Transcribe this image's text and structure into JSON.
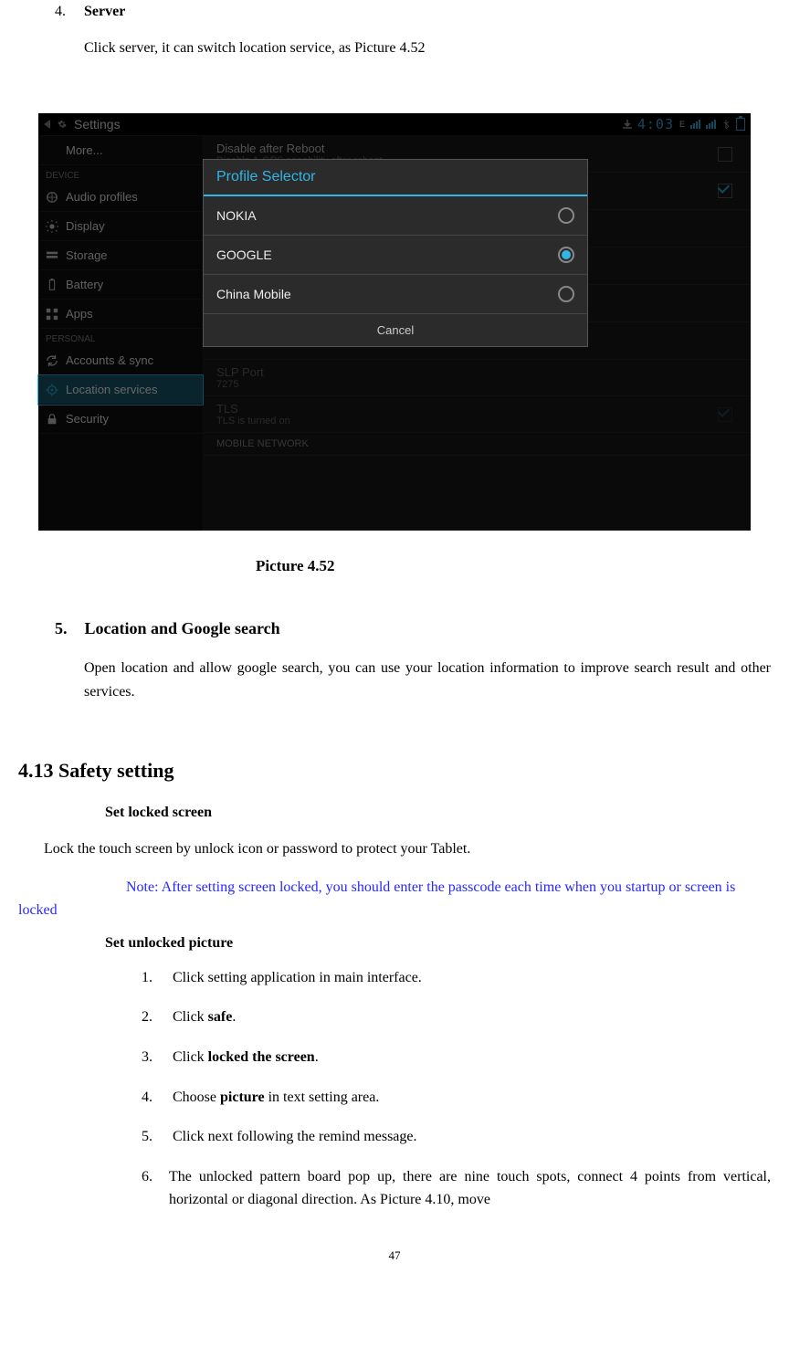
{
  "item4": {
    "num": "4.",
    "title": "Server",
    "body": "Click server, it can switch location service, as Picture 4.52"
  },
  "screenshot": {
    "statusbar": {
      "title": "Settings",
      "clock": "4:03"
    },
    "left_panel": {
      "more": "More...",
      "device_header": "DEVICE",
      "audio": "Audio profiles",
      "display": "Display",
      "storage": "Storage",
      "battery": "Battery",
      "apps": "Apps",
      "personal_header": "PERSONAL",
      "accounts": "Accounts & sync",
      "location": "Location services",
      "security": "Security"
    },
    "right_panel": {
      "disable_title": "Disable after Reboot",
      "disable_sub": "Disable A-GPS capability after reboot",
      "slp_title": "SLP Port",
      "slp_sub": "7275",
      "tls_title": "TLS",
      "tls_sub": "TLS is turned on",
      "mobile_header": "MOBILE NETWORK"
    },
    "dialog": {
      "title": "Profile Selector",
      "opt1": "NOKIA",
      "opt2": "GOOGLE",
      "opt3": "China Mobile",
      "cancel": "Cancel"
    }
  },
  "caption": "Picture 4.52",
  "item5": {
    "num": "5.",
    "title": "Location and Google search",
    "body": "Open location and allow google search, you can use your location information to improve search result and other services."
  },
  "heading413": "4.13  Safety setting",
  "sub_locked": "Set locked screen",
  "lock_line": "Lock the touch screen by unlock icon or password to protect your Tablet.",
  "note_blue": "Note: After setting screen locked, you should enter the passcode each time when you startup or screen is locked",
  "sub_unlocked": "Set unlocked picture",
  "steps": {
    "s1n": "1.",
    "s1": "Click setting application in main interface.",
    "s2n": "2.",
    "s2a": "Click ",
    "s2b": "safe",
    "s2c": ".",
    "s3n": "3.",
    "s3a": "Click ",
    "s3b": "locked the screen",
    "s3c": ".",
    "s4n": "4.",
    "s4a": "Choose ",
    "s4b": "picture",
    "s4c": " in text setting area.",
    "s5n": "5.",
    "s5": "Click next following the remind message.",
    "s6n": "6.",
    "s6": "The unlocked pattern board pop up, there are nine touch spots, connect 4 points from vertical, horizontal or diagonal direction. As Picture 4.10, move"
  },
  "page_num": "47"
}
